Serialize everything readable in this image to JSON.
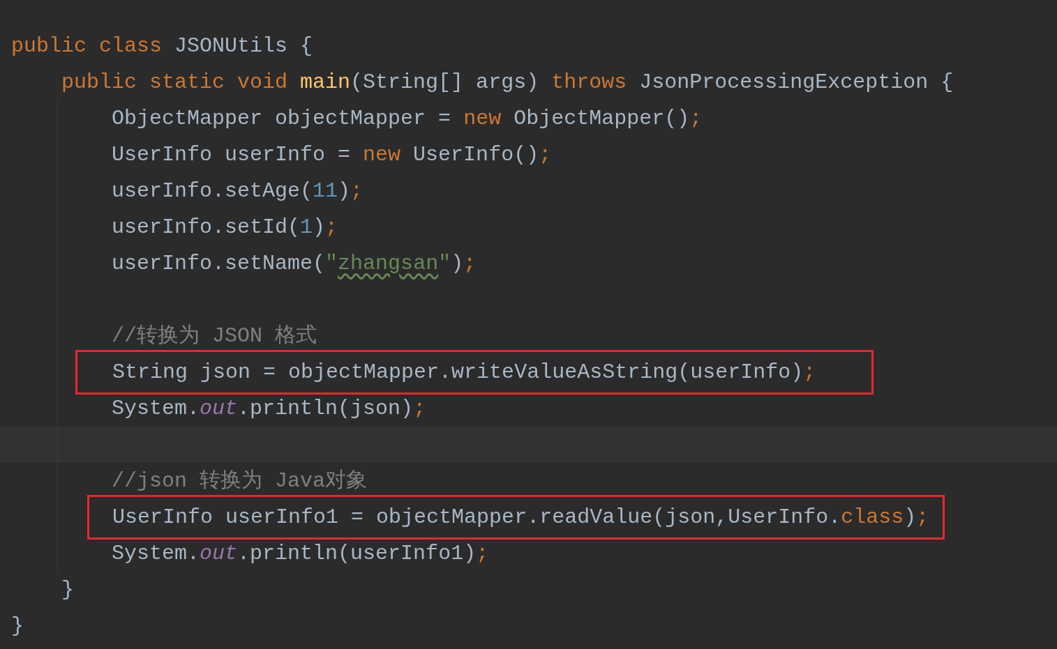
{
  "editor": {
    "lines": [
      {
        "kind": "code",
        "tokens": [
          {
            "text": "public class ",
            "kind": "keyword"
          },
          {
            "text": "JSONUtils {",
            "kind": "plain"
          }
        ]
      },
      {
        "kind": "code",
        "tokens": [
          {
            "text": "    public static void ",
            "kind": "keyword"
          },
          {
            "text": "main",
            "kind": "method"
          },
          {
            "text": "(String[] args) ",
            "kind": "plain"
          },
          {
            "text": "throws ",
            "kind": "keyword"
          },
          {
            "text": "JsonProcessingException {",
            "kind": "plain"
          }
        ]
      },
      {
        "kind": "code",
        "tokens": [
          {
            "text": "        ObjectMapper objectMapper = ",
            "kind": "plain"
          },
          {
            "text": "new ",
            "kind": "keyword"
          },
          {
            "text": "ObjectMapper()",
            "kind": "plain"
          },
          {
            "text": ";",
            "kind": "keyword"
          }
        ]
      },
      {
        "kind": "code",
        "tokens": [
          {
            "text": "        UserInfo userInfo = ",
            "kind": "plain"
          },
          {
            "text": "new ",
            "kind": "keyword"
          },
          {
            "text": "UserInfo()",
            "kind": "plain"
          },
          {
            "text": ";",
            "kind": "keyword"
          }
        ]
      },
      {
        "kind": "code",
        "tokens": [
          {
            "text": "        userInfo.setAge(",
            "kind": "plain"
          },
          {
            "text": "11",
            "kind": "number"
          },
          {
            "text": ")",
            "kind": "plain"
          },
          {
            "text": ";",
            "kind": "keyword"
          }
        ]
      },
      {
        "kind": "code",
        "tokens": [
          {
            "text": "        userInfo.setId(",
            "kind": "plain"
          },
          {
            "text": "1",
            "kind": "number"
          },
          {
            "text": ")",
            "kind": "plain"
          },
          {
            "text": ";",
            "kind": "keyword"
          }
        ]
      },
      {
        "kind": "code",
        "tokens": [
          {
            "text": "        userInfo.setName(",
            "kind": "plain"
          },
          {
            "text": "\"",
            "kind": "string"
          },
          {
            "text": "zhangsan",
            "kind": "string-typo"
          },
          {
            "text": "\"",
            "kind": "string"
          },
          {
            "text": ")",
            "kind": "plain"
          },
          {
            "text": ";",
            "kind": "keyword"
          }
        ]
      },
      {
        "kind": "blank"
      },
      {
        "kind": "code",
        "tokens": [
          {
            "text": "        //转换为 JSON 格式",
            "kind": "comment"
          }
        ]
      },
      {
        "kind": "boxed",
        "tokens": [
          {
            "text": "        String json = objectMapper.writeValueAsString(userInfo)",
            "kind": "plain"
          },
          {
            "text": ";",
            "kind": "keyword"
          }
        ]
      },
      {
        "kind": "code",
        "tokens": [
          {
            "text": "        System.",
            "kind": "plain"
          },
          {
            "text": "out",
            "kind": "field"
          },
          {
            "text": ".println(json)",
            "kind": "plain"
          },
          {
            "text": ";",
            "kind": "keyword"
          }
        ]
      },
      {
        "kind": "current"
      },
      {
        "kind": "code",
        "tokens": [
          {
            "text": "        //json 转换为 Java对象",
            "kind": "comment"
          }
        ]
      },
      {
        "kind": "boxed",
        "tokens": [
          {
            "text": "        UserInfo userInfo1 = objectMapper.readValue(json,UserInfo.",
            "kind": "plain"
          },
          {
            "text": "class",
            "kind": "keyword"
          },
          {
            "text": ")",
            "kind": "plain"
          },
          {
            "text": ";",
            "kind": "keyword"
          }
        ]
      },
      {
        "kind": "code",
        "tokens": [
          {
            "text": "        System.",
            "kind": "plain"
          },
          {
            "text": "out",
            "kind": "field"
          },
          {
            "text": ".println(userInfo1)",
            "kind": "plain"
          },
          {
            "text": ";",
            "kind": "keyword"
          }
        ]
      },
      {
        "kind": "code",
        "tokens": [
          {
            "text": "    }",
            "kind": "plain"
          }
        ]
      },
      {
        "kind": "code",
        "tokens": [
          {
            "text": "}",
            "kind": "plain"
          }
        ]
      }
    ]
  }
}
